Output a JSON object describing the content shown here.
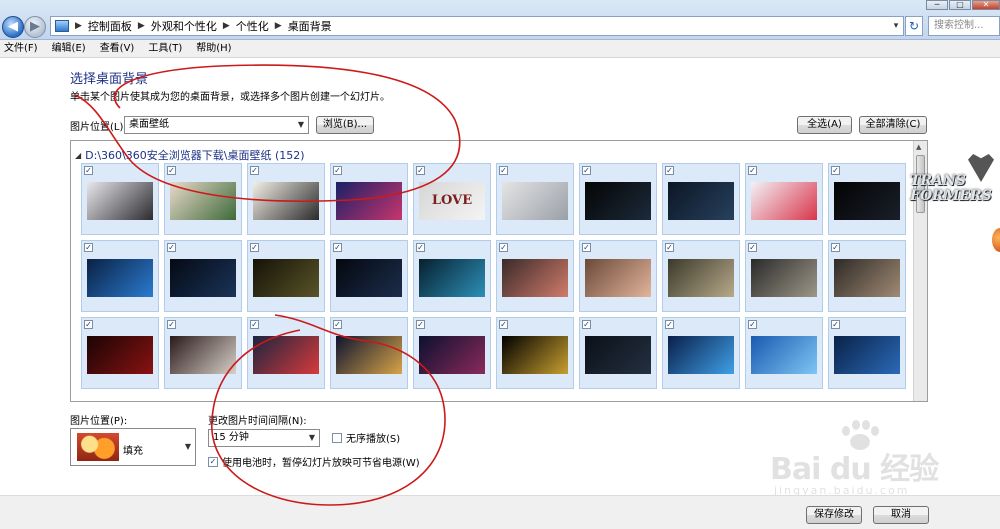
{
  "window": {
    "breadcrumb": [
      "控制面板",
      "外观和个性化",
      "个性化",
      "桌面背景"
    ],
    "search_placeholder": "搜索控制...",
    "controls": {
      "min": "─",
      "max": "□",
      "close": "✕"
    },
    "nav": {
      "back": "◀",
      "forward": "▶",
      "refresh": "↻",
      "dropdown": "▾"
    }
  },
  "menu": [
    "文件(F)",
    "编辑(E)",
    "查看(V)",
    "工具(T)",
    "帮助(H)"
  ],
  "page": {
    "title": "选择桌面背景",
    "subtitle": "单击某个图片使其成为您的桌面背景，或选择多个图片创建一个幻灯片。",
    "picture_location_label": "图片位置(L):",
    "picture_location_value": "桌面壁纸",
    "browse_label": "浏览(B)...",
    "select_all_label": "全选(A)",
    "clear_all_label": "全部清除(C)"
  },
  "gallery": {
    "group_header": "D:\\360\\360安全浏览器下载\\桌面壁纸 (152)",
    "checkmark": "✓",
    "tiles": [
      {
        "thumb": "portrait-girl",
        "colors": [
          "#e8e8ec",
          "#2b2b30"
        ],
        "checked": true
      },
      {
        "thumb": "anime-characters",
        "colors": [
          "#e9d9c9",
          "#3d6a3a"
        ],
        "checked": true
      },
      {
        "thumb": "one-piece-crew",
        "colors": [
          "#f3efe6",
          "#2a2a2a"
        ],
        "checked": true
      },
      {
        "thumb": "nebula",
        "colors": [
          "#1a2066",
          "#c8356e"
        ],
        "checked": true
      },
      {
        "thumb": "love-text",
        "colors": [
          "#d6d6d6",
          "#f4f4f4"
        ],
        "checked": true,
        "label": "LOVE"
      },
      {
        "thumb": "splash-figure",
        "colors": [
          "#e4e4e4",
          "#9aa0a8"
        ],
        "checked": true
      },
      {
        "thumb": "windows7-dark",
        "colors": [
          "#050505",
          "#1c2a3a"
        ],
        "checked": true
      },
      {
        "thumb": "windows7-light",
        "colors": [
          "#0b1624",
          "#27415e"
        ],
        "checked": true
      },
      {
        "thumb": "colorful-balls",
        "colors": [
          "#f2f2f6",
          "#d9354a"
        ],
        "checked": true
      },
      {
        "thumb": "windows7-black",
        "colors": [
          "#030303",
          "#1a1f2a"
        ],
        "checked": true
      },
      {
        "thumb": "blue-flare",
        "colors": [
          "#0a2244",
          "#2b7ad0"
        ],
        "checked": true
      },
      {
        "thumb": "dark-streak",
        "colors": [
          "#050a14",
          "#1a3358"
        ],
        "checked": true
      },
      {
        "thumb": "windows7-gold",
        "colors": [
          "#141208",
          "#5a5428"
        ],
        "checked": true
      },
      {
        "thumb": "dark-streak-2",
        "colors": [
          "#040810",
          "#1c2d4a"
        ],
        "checked": true
      },
      {
        "thumb": "windows7-teal",
        "colors": [
          "#06202e",
          "#2d8fb8"
        ],
        "checked": true
      },
      {
        "thumb": "ff13-lightning",
        "colors": [
          "#3a2a2a",
          "#d17b6a"
        ],
        "checked": true
      },
      {
        "thumb": "ff13-portrait",
        "colors": [
          "#6a4a3a",
          "#e3b49a"
        ],
        "checked": true
      },
      {
        "thumb": "battle-scene",
        "colors": [
          "#3a3a2a",
          "#b8a98a"
        ],
        "checked": true
      },
      {
        "thumb": "battle-scene-2",
        "colors": [
          "#2a2a2a",
          "#9d9788"
        ],
        "checked": true
      },
      {
        "thumb": "battle-scene-3",
        "colors": [
          "#2e2a26",
          "#a08a74"
        ],
        "checked": true
      },
      {
        "thumb": "red-dark-figure",
        "colors": [
          "#1a0404",
          "#8a1212"
        ],
        "checked": true
      },
      {
        "thumb": "swordsman",
        "colors": [
          "#2a1a1a",
          "#d8d0c8"
        ],
        "checked": true
      },
      {
        "thumb": "anime-hero",
        "colors": [
          "#1a2440",
          "#d83a3a"
        ],
        "checked": true
      },
      {
        "thumb": "golden-galaxy",
        "colors": [
          "#0e1430",
          "#d8a448"
        ],
        "checked": true
      },
      {
        "thumb": "space-clouds",
        "colors": [
          "#0c1030",
          "#8a2a5a"
        ],
        "checked": true
      },
      {
        "thumb": "planet-horizon",
        "colors": [
          "#000000",
          "#c8a030"
        ],
        "checked": true
      },
      {
        "thumb": "text-dark",
        "colors": [
          "#0a1018",
          "#243040"
        ],
        "checked": true
      },
      {
        "thumb": "windows-logo-blue",
        "colors": [
          "#0a1f4a",
          "#3fa0e8"
        ],
        "checked": true
      },
      {
        "thumb": "windows7-sky",
        "colors": [
          "#1a5ab0",
          "#7ec6f4"
        ],
        "checked": true
      },
      {
        "thumb": "windows7-deepblue",
        "colors": [
          "#0a2248",
          "#2a6ab8"
        ],
        "checked": true
      }
    ]
  },
  "settings": {
    "position_label": "图片位置(P):",
    "position_value": "填充",
    "interval_label": "更改图片时间间隔(N):",
    "interval_value": "15 分钟",
    "shuffle_label": "无序播放(S)",
    "shuffle_checked": false,
    "battery_label": "使用电池时，暂停幻灯片放映可节省电源(W)",
    "battery_checked": true
  },
  "footer": {
    "save_label": "保存修改",
    "cancel_label": "取消"
  },
  "desktop_peek": {
    "wordmark_line1": "TRANS",
    "wordmark_line2": "FORMERS"
  },
  "watermark": {
    "brand": "Bai du 经验",
    "url": "jingyan.baidu.com"
  },
  "annotation_color": "#cc1a1a"
}
